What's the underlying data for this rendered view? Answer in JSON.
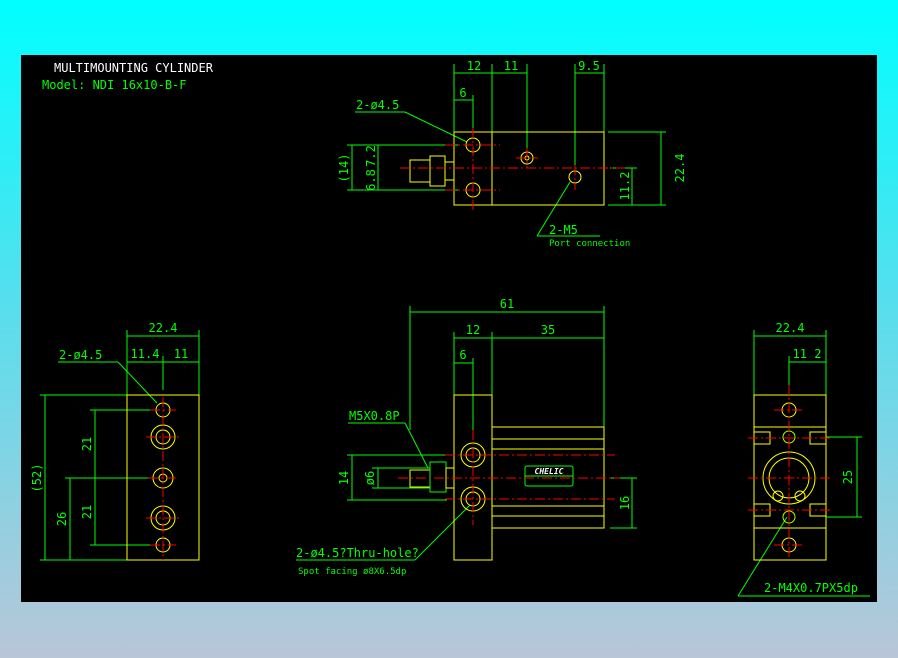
{
  "title_block": {
    "title": "MULTIMOUNTING CYLINDER",
    "model": "Model: NDI 16x10-B-F"
  },
  "top_view": {
    "dims": {
      "d12": "12",
      "d11": "11",
      "d9_5": "9.5",
      "d6": "6",
      "d14": "(14)",
      "d6_8": "6.8",
      "d7_2": "7.2",
      "d22_4": "22.4",
      "d11_2": "11.2"
    },
    "hole_callout": "2-ø4.5",
    "port_callout": "2-M5",
    "port_note": "Port connection"
  },
  "front_view": {
    "dims": {
      "d61": "61",
      "d12": "12",
      "d35": "35",
      "d6": "6",
      "d14": "14",
      "dphi6": "ø6",
      "d16": "16"
    },
    "thread_callout": "M5X0.8P",
    "hole_callout": "2-ø4.5?Thru-hole?",
    "spot_note": "Spot facing ø8X6.5dp",
    "brand_label": "CHELIC"
  },
  "left_view": {
    "dims": {
      "d22_4": "22.4",
      "d11_4": "11.4",
      "d11": "11",
      "d52": "(52)",
      "d21a": "21",
      "d21b": "21",
      "d26": "26"
    },
    "hole_callout": "2-ø4.5"
  },
  "right_view": {
    "dims": {
      "d22_4": "22.4",
      "d11_2": "11 2",
      "d25": "25"
    },
    "thread_callout": "2-M4X0.7PX5dp"
  },
  "colors": {
    "background": "#000000",
    "outline": "#ffff00",
    "dimension": "#00ff00",
    "centerline": "#ff0000"
  }
}
